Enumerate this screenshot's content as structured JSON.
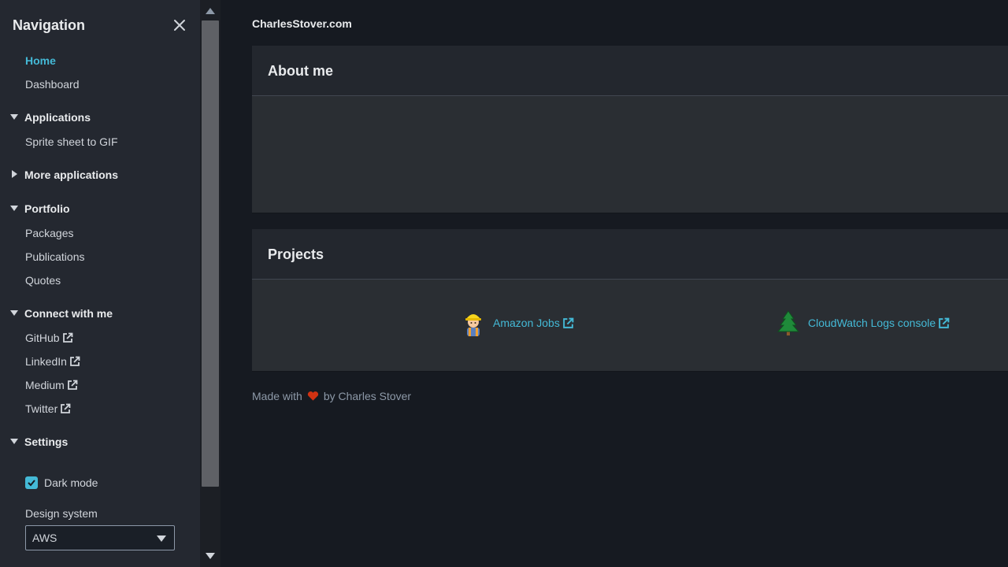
{
  "sidebar": {
    "title": "Navigation",
    "links_top": [
      {
        "label": "Home",
        "active": true
      },
      {
        "label": "Dashboard"
      }
    ],
    "sections": {
      "applications": {
        "label": "Applications",
        "expanded": true,
        "items": [
          "Sprite sheet to GIF"
        ]
      },
      "more_applications": {
        "label": "More applications",
        "expanded": false
      },
      "portfolio": {
        "label": "Portfolio",
        "expanded": true,
        "items": [
          "Packages",
          "Publications",
          "Quotes"
        ]
      },
      "connect": {
        "label": "Connect with me",
        "expanded": true,
        "items": [
          "GitHub",
          "LinkedIn",
          "Medium",
          "Twitter"
        ]
      },
      "settings": {
        "label": "Settings",
        "expanded": true
      }
    },
    "settings": {
      "dark_mode_label": "Dark mode",
      "dark_mode_checked": true,
      "design_system_label": "Design system",
      "design_system_value": "AWS"
    }
  },
  "main": {
    "site_title": "CharlesStover.com",
    "about_title": "About me",
    "projects_title": "Projects",
    "projects": [
      {
        "label": "Amazon Jobs",
        "icon": "construction-worker-emoji"
      },
      {
        "label": "CloudWatch Logs console",
        "icon": "evergreen-tree-emoji"
      }
    ],
    "footer": {
      "prefix": "Made with",
      "suffix": "by Charles Stover"
    }
  },
  "colors": {
    "accent": "#44b9d6",
    "background": "#161a21",
    "sidebar": "#242830",
    "card": "#2a2e33",
    "heart": "#d13212"
  }
}
